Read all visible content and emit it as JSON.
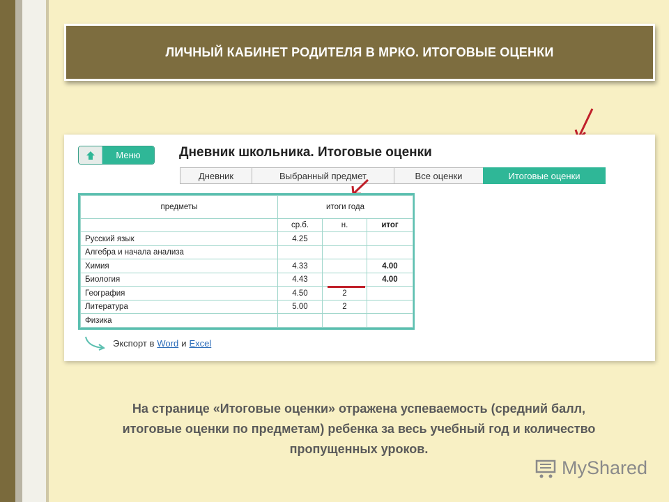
{
  "title": "ЛИЧНЫЙ КАБИНЕТ РОДИТЕЛЯ  В МРКО. ИТОГОВЫЕ ОЦЕНКИ",
  "screenshot": {
    "menu_label": "Меню",
    "page_title": "Дневник школьника. Итоговые оценки",
    "tabs": [
      {
        "label": "Дневник",
        "active": false
      },
      {
        "label": "Выбранный предмет",
        "active": false
      },
      {
        "label": "Все оценки",
        "active": false
      },
      {
        "label": "Итоговые оценки",
        "active": true
      }
    ],
    "table": {
      "subjects_header": "предметы",
      "year_header": "итоги года",
      "col_avg": "ср.б.",
      "col_absent": "н.",
      "col_final": "итог",
      "rows": [
        {
          "subject": "Русский язык",
          "avg": "4.25",
          "absent": "",
          "final": ""
        },
        {
          "subject": "Алгебра и начала анализа",
          "avg": "",
          "absent": "",
          "final": ""
        },
        {
          "subject": "Химия",
          "avg": "4.33",
          "absent": "",
          "final": "4.00"
        },
        {
          "subject": "Биология",
          "avg": "4.43",
          "absent": "",
          "final": "4.00"
        },
        {
          "subject": "География",
          "avg": "4.50",
          "absent": "2",
          "final": ""
        },
        {
          "subject": "Литература",
          "avg": "5.00",
          "absent": "2",
          "final": ""
        },
        {
          "subject": "Физика",
          "avg": "",
          "absent": "",
          "final": ""
        }
      ]
    },
    "export_prefix": "Экспорт в",
    "export_word": "Word",
    "export_and": "и",
    "export_excel": "Excel"
  },
  "caption": [
    "На странице «Итоговые оценки» отражена успеваемость (средний балл,",
    "итоговые оценки по предметам) ребенка за весь учебный год и количество",
    "пропущенных уроков."
  ],
  "logo": "MyShared",
  "colors": {
    "background": "#f8f0c4",
    "title_bar": "#7d6d3f",
    "accent_green": "#2fb797",
    "arrow_red": "#c0202a"
  }
}
